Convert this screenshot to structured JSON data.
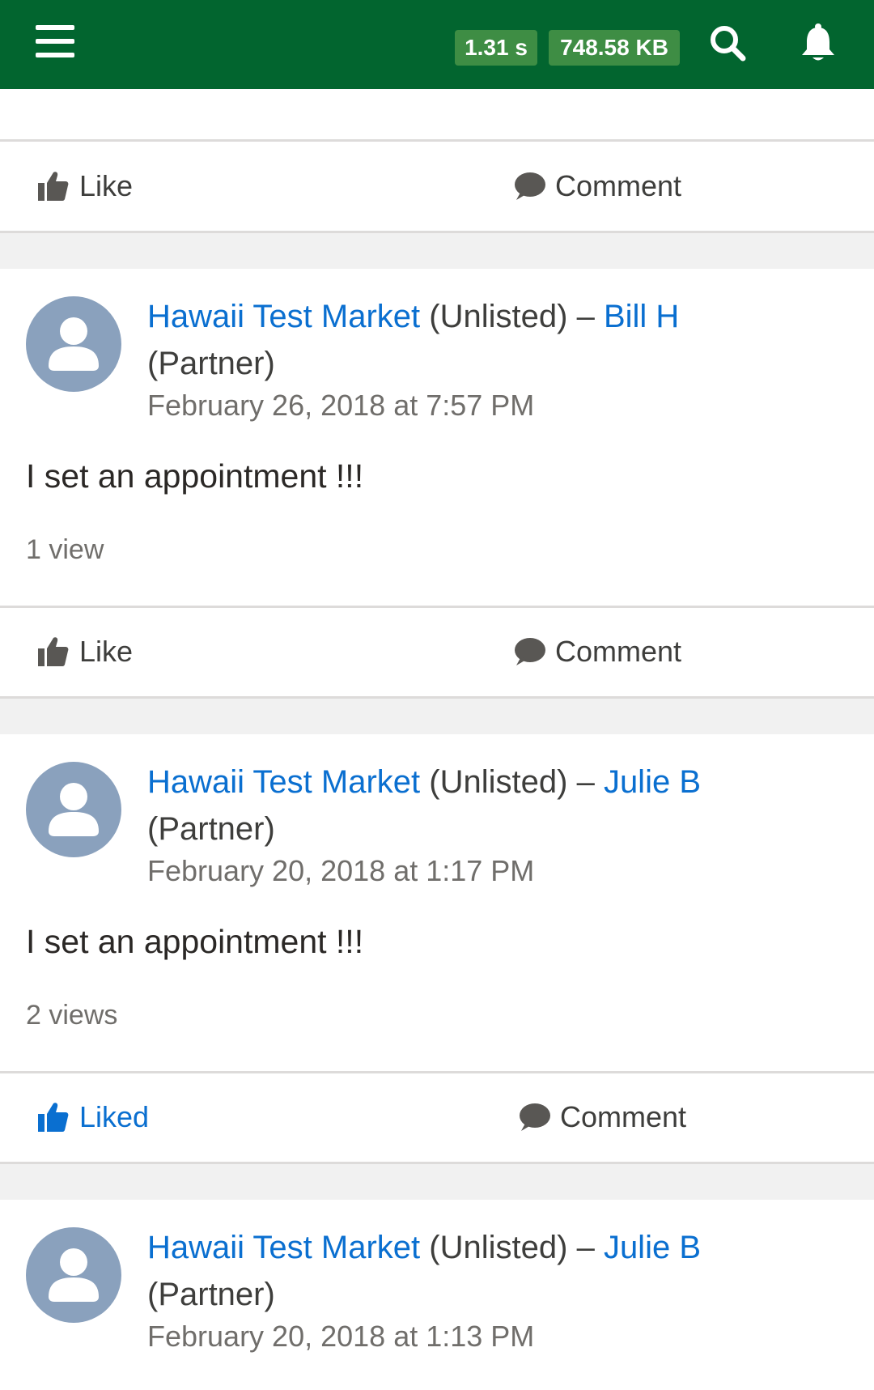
{
  "topbar": {
    "time_badge": "1.31 s",
    "size_badge": "748.58 KB",
    "icons": [
      "menu-icon",
      "search-icon",
      "bell-icon"
    ],
    "background_color": "#02652f",
    "badge_color": "#3e8d44"
  },
  "actions_top": {
    "like": "Like",
    "comment": "Comment"
  },
  "posts": [
    {
      "group": "Hawaii Test Market",
      "qualifier": "(Unlisted)",
      "separator": "–",
      "author": "Bill H",
      "role": "(Partner)",
      "date": "February 26, 2018 at 7:57 PM",
      "body": "I set an appointment !!!",
      "views": "1 view",
      "like_label": "Like",
      "liked": false,
      "comment_label": "Comment"
    },
    {
      "group": "Hawaii Test Market",
      "qualifier": "(Unlisted)",
      "separator": "–",
      "author": "Julie B",
      "role": "(Partner)",
      "date": "February 20, 2018 at 1:17 PM",
      "body": "I set an appointment !!!",
      "views": "2 views",
      "like_label": "Liked",
      "liked": true,
      "comment_label": "Comment"
    },
    {
      "group": "Hawaii Test Market",
      "qualifier": "(Unlisted)",
      "separator": "–",
      "author": "Julie B",
      "role": "(Partner)",
      "date": "February 20, 2018 at 1:13 PM"
    }
  ],
  "colors": {
    "link": "#0a6fd0",
    "avatar": "#8aa1bd",
    "muted_text": "#706e6b"
  }
}
